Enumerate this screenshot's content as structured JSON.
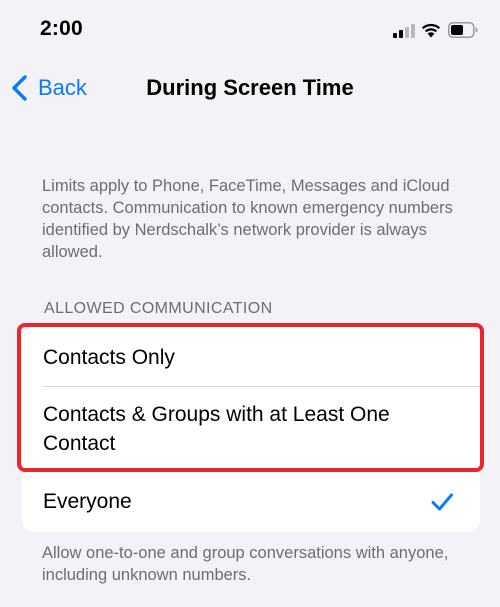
{
  "status_bar": {
    "time": "2:00"
  },
  "nav": {
    "back_label": "Back",
    "title": "During Screen Time"
  },
  "intro": {
    "text": "Limits apply to Phone, FaceTime, Messages and iCloud contacts. Communication to known emergency numbers identified by Nerdschalk’s network provider is always allowed."
  },
  "section": {
    "header": "ALLOWED COMMUNICATION",
    "options": [
      {
        "label": "Contacts Only",
        "selected": false
      },
      {
        "label": "Contacts & Groups with at Least One Contact",
        "selected": false
      },
      {
        "label": "Everyone",
        "selected": true
      }
    ],
    "footer": "Allow one-to-one and group conversations with anyone, including unknown numbers."
  },
  "colors": {
    "accent": "#0a7aff",
    "highlight": "#e8262e",
    "background": "#f2f2f7",
    "secondary_text": "#6d6d72"
  }
}
